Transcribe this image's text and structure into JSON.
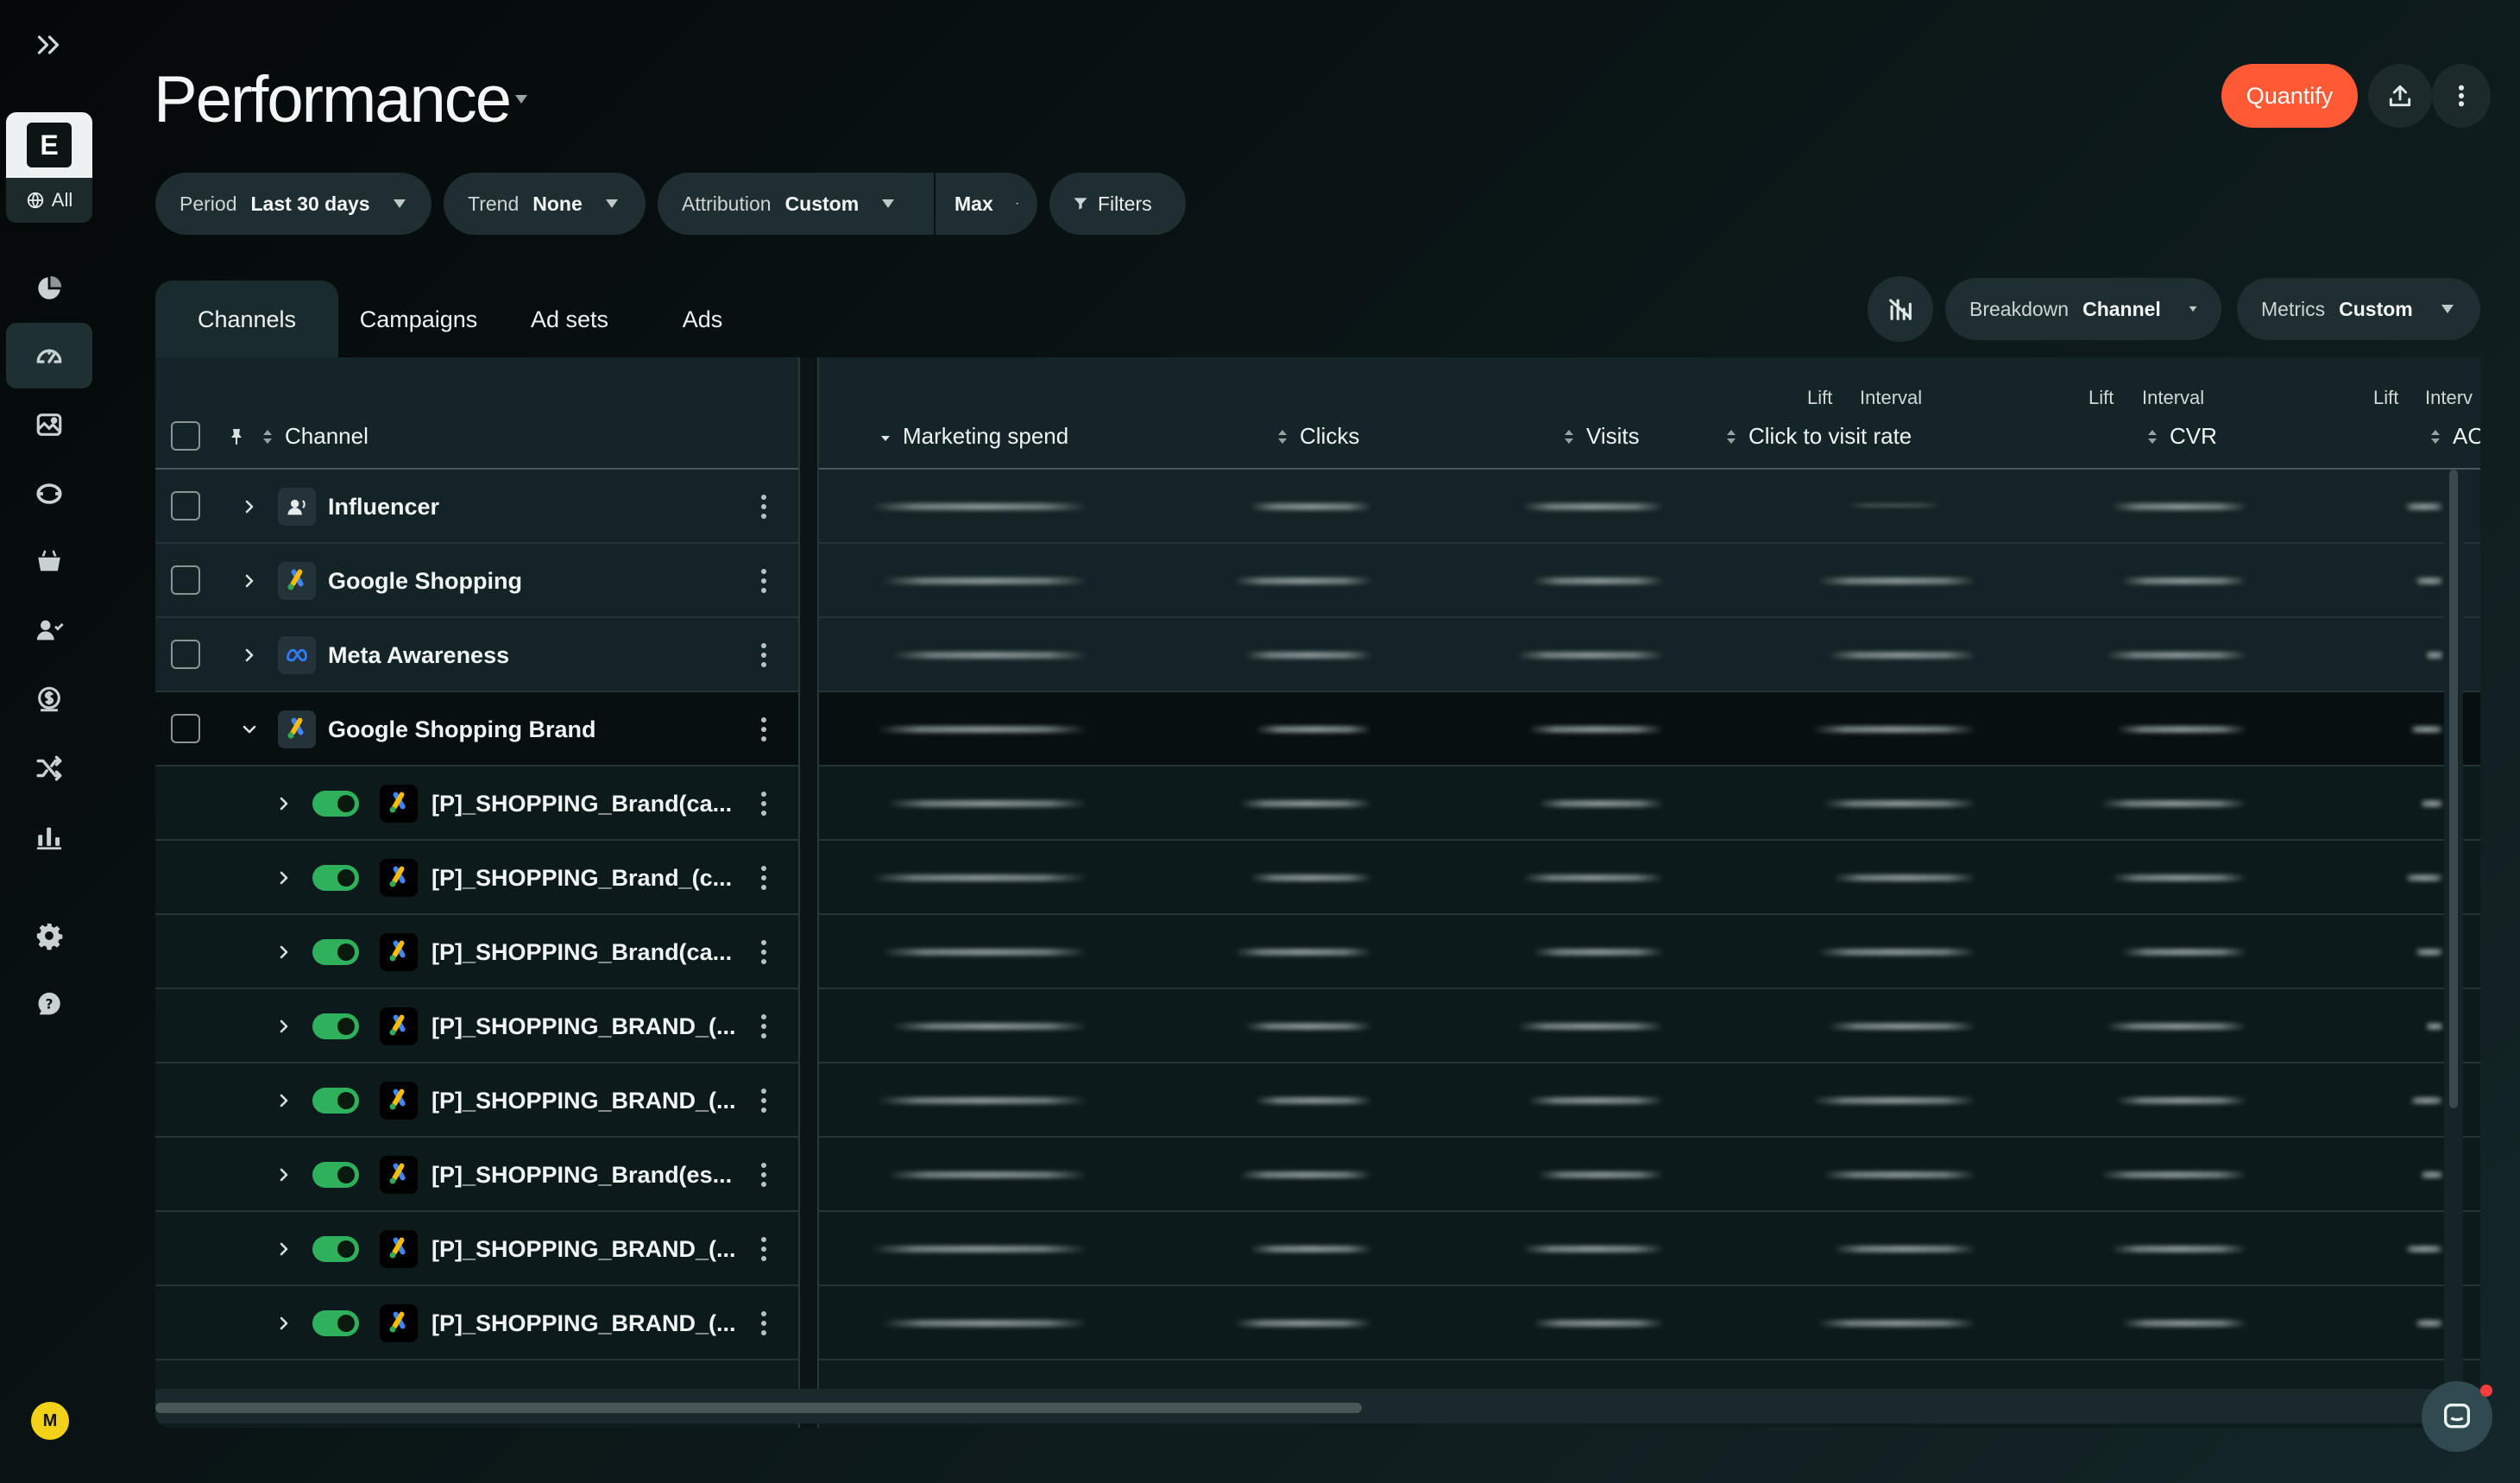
{
  "sidebar": {
    "workspace_letter": "E",
    "workspace_scope": "All",
    "avatar_initial": "M",
    "nav": [
      {
        "name": "dashboard-icon"
      },
      {
        "name": "performance-gauge-icon",
        "active": true
      },
      {
        "name": "creatives-icon"
      },
      {
        "name": "orbit-icon"
      },
      {
        "name": "basket-icon"
      },
      {
        "name": "users-icon"
      },
      {
        "name": "revenue-icon"
      },
      {
        "name": "shuffle-icon"
      },
      {
        "name": "bar-chart-icon"
      },
      {
        "name": "settings-icon"
      },
      {
        "name": "help-icon"
      }
    ]
  },
  "header": {
    "title": "Performance",
    "quantify_label": "Quantify"
  },
  "filters": {
    "period": {
      "label": "Period",
      "value": "Last 30 days"
    },
    "trend": {
      "label": "Trend",
      "value": "None"
    },
    "attribution": {
      "label": "Attribution",
      "value": "Custom"
    },
    "window": {
      "value": "Max"
    },
    "filters_label": "Filters"
  },
  "tabs": [
    "Channels",
    "Campaigns",
    "Ad sets",
    "Ads"
  ],
  "controls": {
    "breakdown": {
      "label": "Breakdown",
      "value": "Channel"
    },
    "metrics": {
      "label": "Metrics",
      "value": "Custom"
    }
  },
  "columns": {
    "channel": "Channel",
    "marketing_spend": "Marketing spend",
    "clicks": "Clicks",
    "visits": "Visits",
    "click_to_visit_rate": "Click to visit rate",
    "cvr": "CVR",
    "aov": "AO",
    "lift": "Lift",
    "interval": "Interval",
    "interval_cut": "Interv"
  },
  "rows": [
    {
      "name": "Influencer",
      "level": 0,
      "icon": "influencer"
    },
    {
      "name": "Google Shopping",
      "level": 0,
      "icon": "google-ads"
    },
    {
      "name": "Meta Awareness",
      "level": 0,
      "icon": "meta"
    },
    {
      "name": "Google Shopping Brand",
      "level": 0,
      "icon": "google-ads",
      "expanded": true
    },
    {
      "name": "[P]_SHOPPING_Brand(ca...",
      "level": 1,
      "icon": "google-ads",
      "enabled": true
    },
    {
      "name": "[P]_SHOPPING_Brand_(c...",
      "level": 1,
      "icon": "google-ads",
      "enabled": true
    },
    {
      "name": "[P]_SHOPPING_Brand(ca...",
      "level": 1,
      "icon": "google-ads",
      "enabled": true
    },
    {
      "name": "[P]_SHOPPING_BRAND_(...",
      "level": 1,
      "icon": "google-ads",
      "enabled": true
    },
    {
      "name": "[P]_SHOPPING_BRAND_(...",
      "level": 1,
      "icon": "google-ads",
      "enabled": true
    },
    {
      "name": "[P]_SHOPPING_Brand(es...",
      "level": 1,
      "icon": "google-ads",
      "enabled": true
    },
    {
      "name": "[P]_SHOPPING_BRAND_(...",
      "level": 1,
      "icon": "google-ads",
      "enabled": true
    },
    {
      "name": "[P]_SHOPPING_BRAND_(...",
      "level": 1,
      "icon": "google-ads",
      "enabled": true
    }
  ]
}
